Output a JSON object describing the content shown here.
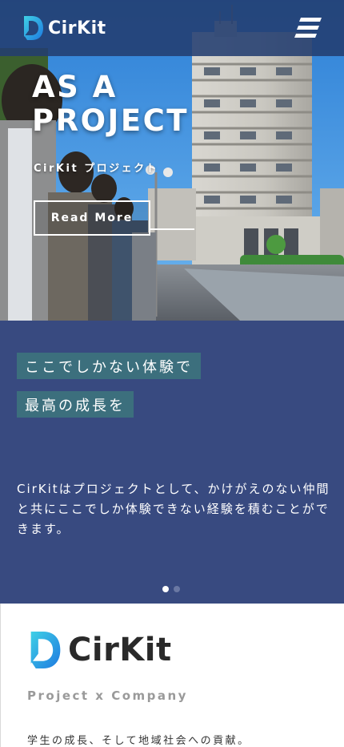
{
  "header": {
    "logo_text": "CirKit",
    "menu_icon": "menu-icon"
  },
  "hero": {
    "title_line1": "AS A",
    "title_line2": "PROJECT",
    "subtitle": "CirKit プロジェクト",
    "read_more_label": "Read More"
  },
  "band": {
    "tag1": "ここでしかない体験で",
    "tag2": "最高の成長を",
    "body": "CirKitはプロジェクトとして、かけがえのない仲間と共にここでしか体験できない経験を積むことができます。",
    "slides_total": 2,
    "slide_active": 1
  },
  "company": {
    "logo_text": "CirKit",
    "tagline": "Project x Company",
    "mission": "学生の成長、そして地域社会への貢献。"
  },
  "colors": {
    "header_bg": "#233e70",
    "band_bg": "#384a80",
    "tag_bg": "#3c6f7d",
    "logo_gradient_start": "#3fd0e6",
    "logo_gradient_end": "#1e7ae0"
  }
}
